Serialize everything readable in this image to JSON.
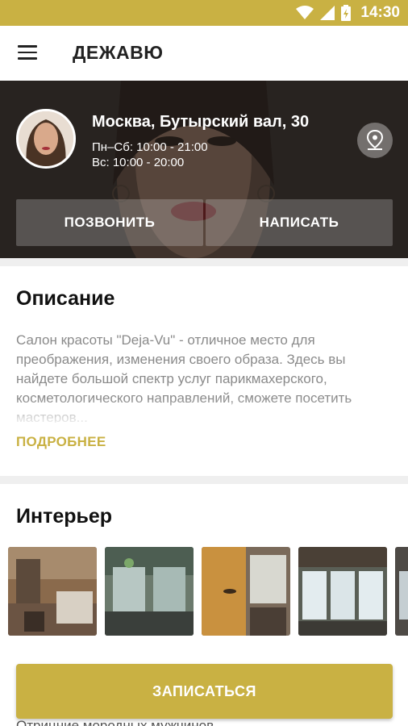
{
  "status_bar": {
    "time": "14:30"
  },
  "app_bar": {
    "title": "ДЕЖАВЮ"
  },
  "salon": {
    "address": "Москва, Бутырский вал, 30",
    "hours_weekdays": "Пн–Сб: 10:00 - 21:00",
    "hours_sunday": "Вс: 10:00 - 20:00"
  },
  "actions": {
    "call_label": "ПОЗВОНИТЬ",
    "write_label": "НАПИСАТЬ"
  },
  "description": {
    "title": "Описание",
    "text": "Салон красоты \"Deja-Vu\" - отличное место для преображения, изменения своего образа. Здесь вы найдете большой спектр услуг парикмахерского, косметологического направлений, сможете посетить мастеров...",
    "more_label": "ПОДРОБНЕЕ"
  },
  "interior": {
    "title": "Интерьер"
  },
  "booking": {
    "button_label": "ЗАПИСАТЬСЯ",
    "next_section_peek": "Отрицние мородных мужчинов"
  },
  "colors": {
    "accent": "#c9b143",
    "hero_overlay": "#2b2623"
  }
}
